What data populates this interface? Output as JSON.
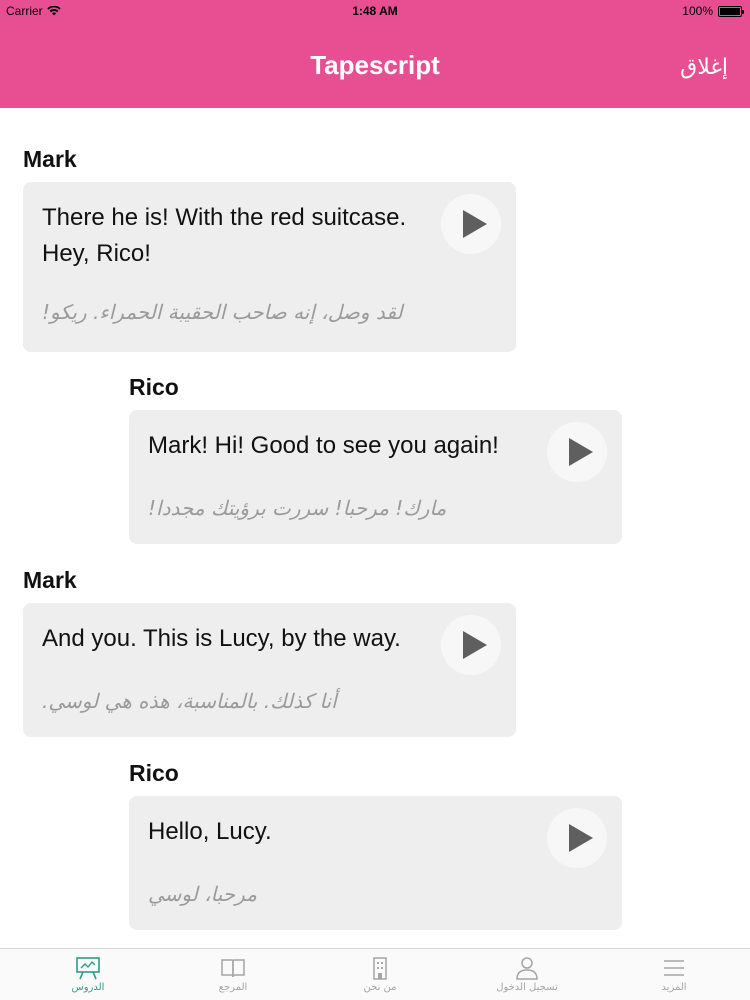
{
  "status_bar": {
    "carrier": "Carrier",
    "time": "1:48 AM",
    "battery": "100%"
  },
  "nav": {
    "title": "Tapescript",
    "close_label": "إغلاق",
    "color": "#e84f93"
  },
  "dialogue": [
    {
      "speaker": "Mark",
      "english_line1": "There he is! With the red suitcase.",
      "english_line2": "Hey, Rico!",
      "arabic": "لقد وصل، إنه صاحب الحقيبة الحمراء. ريكو!"
    },
    {
      "speaker": "Rico",
      "english_line1": "Mark! Hi! Good to see you again!",
      "arabic": "مارك! مرحبا! سررت برؤيتك مجددا!"
    },
    {
      "speaker": "Mark",
      "english_line1": "And you. This is Lucy, by the way.",
      "arabic": "أنا كذلك. بالمناسبة، هذه هي لوسي."
    },
    {
      "speaker": "Rico",
      "english_line1": "Hello, Lucy.",
      "arabic": "مرحبا، لوسي"
    }
  ],
  "tabs": [
    {
      "label": "الدروس",
      "icon": "lessons-board-icon",
      "active": true
    },
    {
      "label": "المرجع",
      "icon": "book-icon",
      "active": false
    },
    {
      "label": "من نحن",
      "icon": "building-icon",
      "active": false
    },
    {
      "label": "تسجيل الدخول",
      "icon": "user-icon",
      "active": false
    },
    {
      "label": "المزيد",
      "icon": "menu-icon",
      "active": false
    }
  ],
  "colors": {
    "accent": "#e84f93",
    "active_tab": "#2f9b87",
    "bubble_bg": "#eeeeee"
  }
}
